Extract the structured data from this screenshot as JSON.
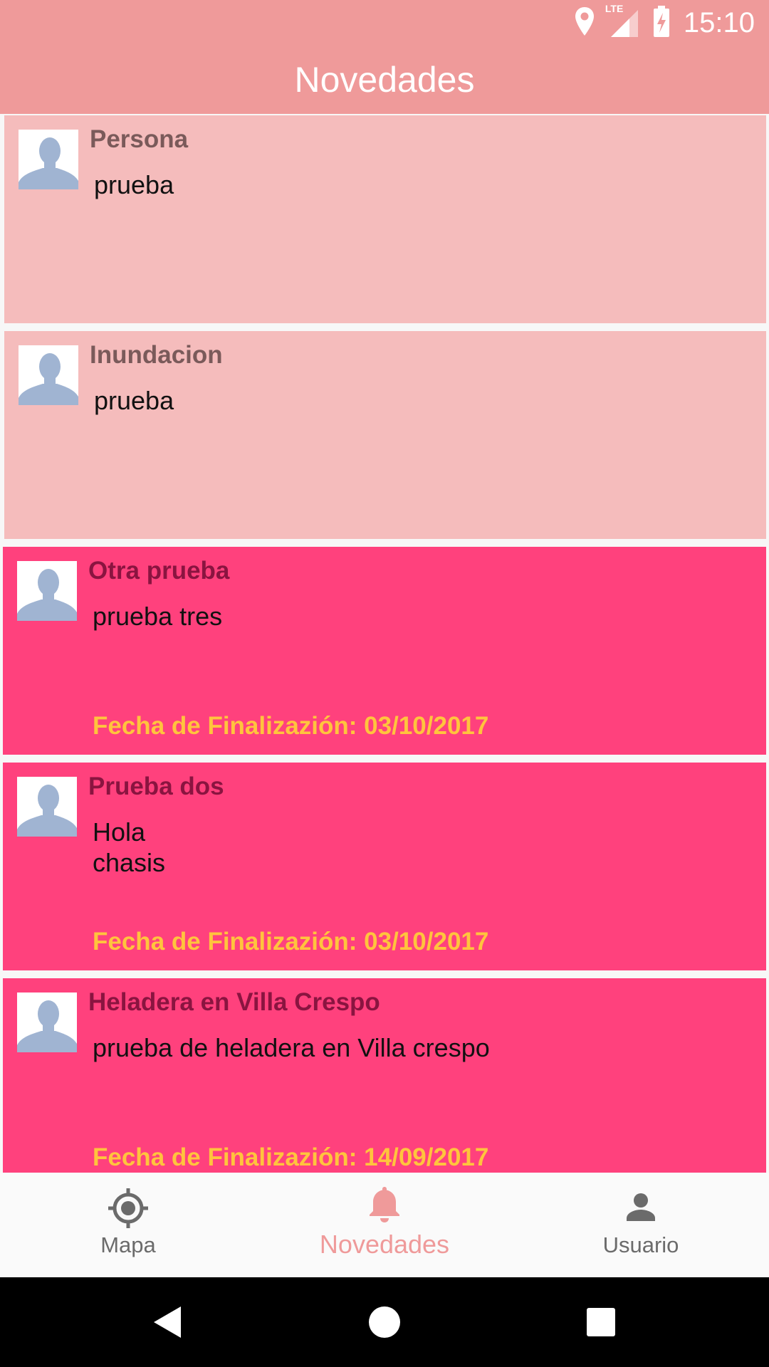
{
  "status_bar": {
    "time": "15:10",
    "network": "LTE",
    "icons": [
      "location-icon",
      "signal-icon",
      "battery-charging-icon"
    ]
  },
  "toolbar": {
    "title": "Novedades"
  },
  "feed": {
    "items": [
      {
        "title": "Persona",
        "body": "prueba",
        "end_date": "",
        "status": "pending"
      },
      {
        "title": "Inundacion",
        "body": "prueba",
        "end_date": "",
        "status": "pending"
      },
      {
        "title": "Otra prueba",
        "body": "prueba tres",
        "end_date": "Fecha de Finalizazión: 03/10/2017",
        "status": "active"
      },
      {
        "title": "Prueba dos",
        "body": "Hola\nchasis",
        "end_date": "Fecha de Finalizazión: 03/10/2017",
        "status": "active"
      },
      {
        "title": "Heladera en Villa Crespo",
        "body": "prueba de heladera en Villa crespo",
        "end_date": "Fecha de Finalizazión: 14/09/2017",
        "status": "active"
      }
    ]
  },
  "bottom_nav": {
    "items": [
      {
        "label": "Mapa",
        "icon": "gps-target-icon",
        "active": false
      },
      {
        "label": "Novedades",
        "icon": "bell-icon",
        "active": true
      },
      {
        "label": "Usuario",
        "icon": "user-icon",
        "active": false
      }
    ]
  },
  "colors": {
    "primary": "#ef9a9a",
    "card_pending": "#f5bcbc",
    "card_active": "#ff417d",
    "date_text": "#ffc43d"
  }
}
